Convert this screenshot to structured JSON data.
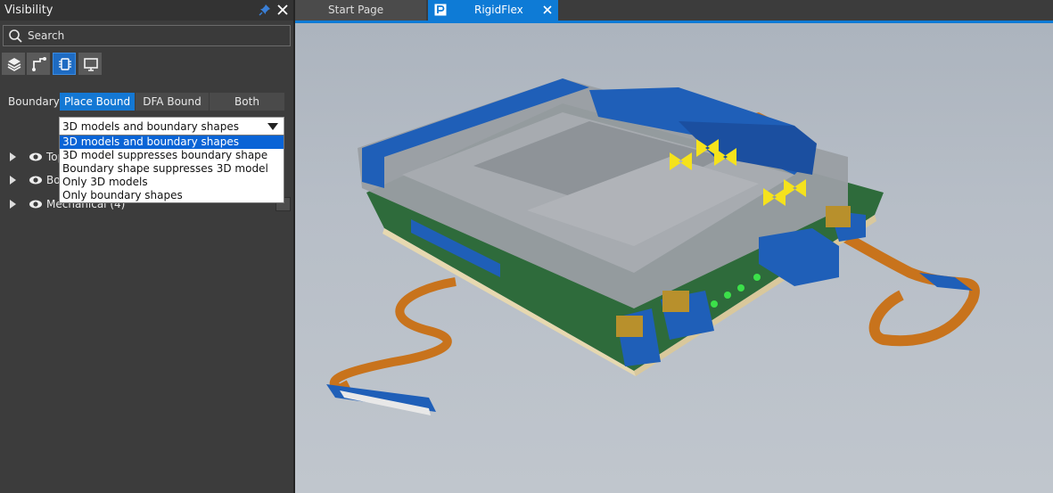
{
  "panel": {
    "title": "Visibility",
    "search_label": "Search",
    "toolbar_icons": [
      "layers-icon",
      "routing-icon",
      "component-icon",
      "display-icon"
    ],
    "active_toolbar_index": 2
  },
  "boundary": {
    "label": "Boundary",
    "options": [
      "Place Bound",
      "DFA Bound",
      "Both"
    ],
    "selected_option": "Place Bound"
  },
  "display_mode": {
    "value": "3D models and boundary shapes",
    "options": [
      "3D models and boundary shapes",
      "3D model suppresses boundary shape",
      "Boundary shape suppresses 3D model",
      "Only 3D models",
      "Only boundary shapes"
    ],
    "highlighted_index": 0
  },
  "tree": {
    "rows": [
      {
        "label": "Top"
      },
      {
        "label": "Bo"
      },
      {
        "label": "Mechanical (4)"
      }
    ]
  },
  "tabs": [
    {
      "label": "Start Page",
      "active": false
    },
    {
      "label": "RigidFlex",
      "active": true
    }
  ],
  "colors": {
    "accent": "#0e7bd6",
    "panel_bg": "#3c3c3c",
    "viewport_bg": "#b3bac3",
    "flex_cable": "#c8731c",
    "boundary_blue": "#1f5fb8",
    "board_green": "#2e6b3b"
  }
}
